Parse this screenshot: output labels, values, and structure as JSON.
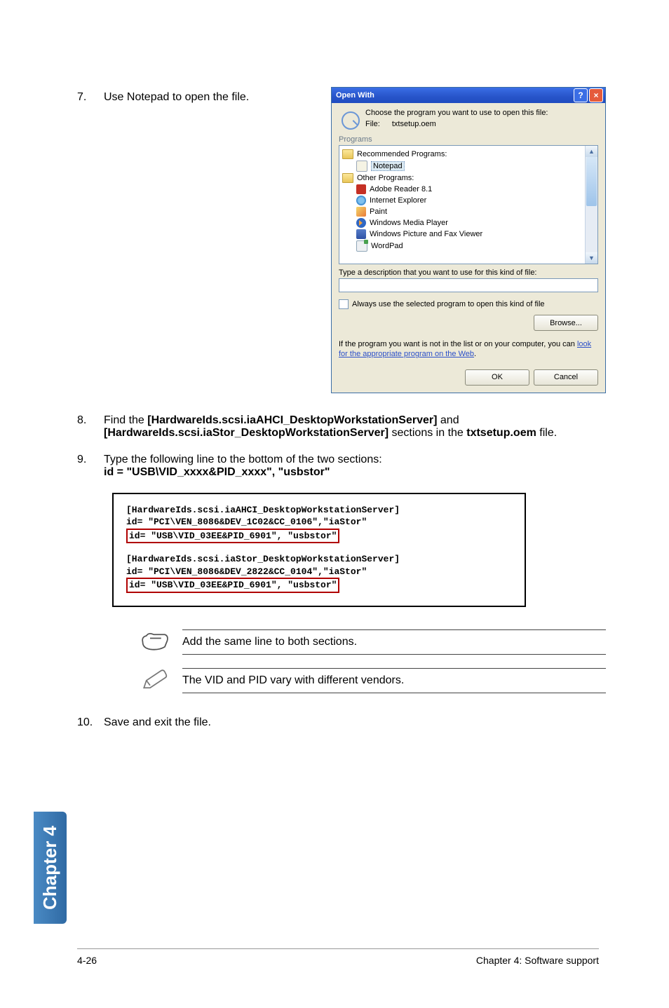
{
  "step7": {
    "num": "7.",
    "text": "Use Notepad to open the file."
  },
  "dialog": {
    "title": "Open With",
    "help": "?",
    "close": "×",
    "choose": "Choose the program you want to use to open this file:",
    "file_label": "File:",
    "file_name": "txtsetup.oem",
    "programs_label": "Programs",
    "grp_rec": "Recommended Programs:",
    "notepad": "Notepad",
    "grp_other": "Other Programs:",
    "adobe": "Adobe Reader 8.1",
    "ie": "Internet Explorer",
    "paint": "Paint",
    "wmp": "Windows Media Player",
    "picfax": "Windows Picture and Fax Viewer",
    "wordpad": "WordPad",
    "desc_label": "Type a description that you want to use for this kind of file:",
    "always": "Always use the selected program to open this kind of file",
    "browse": "Browse...",
    "weblook_a": "If the program you want is not in the list or on your computer, you can ",
    "weblook_link": "look for the appropriate program on the Web",
    "weblook_b": ".",
    "ok": "OK",
    "cancel": "Cancel"
  },
  "step8": {
    "num": "8.",
    "a": "Find the ",
    "b": "[HardwareIds.scsi.iaAHCI_DesktopWorkstationServer]",
    "c": " and ",
    "d": "[HardwareIds.scsi.iaStor_DesktopWorkstationServer]",
    "e": " sections in the ",
    "f": "txtsetup.oem",
    "g": " file."
  },
  "step9": {
    "num": "9.",
    "a": "Type the following line to the bottom of the two sections:",
    "b": "id = \"USB\\VID_xxxx&PID_xxxx\", \"usbstor\""
  },
  "code": {
    "l1": "[HardwareIds.scsi.iaAHCI_DesktopWorkstationServer]",
    "l2": "id= \"PCI\\VEN_8086&DEV_1C02&CC_0106\",\"iaStor\"",
    "l3": "id= \"USB\\VID_03EE&PID_6901\", \"usbstor\"",
    "l4": "[HardwareIds.scsi.iaStor_DesktopWorkstationServer]",
    "l5": "id= \"PCI\\VEN_8086&DEV_2822&CC_0104\",\"iaStor\"",
    "l6": "id= \"USB\\VID_03EE&PID_6901\", \"usbstor\""
  },
  "note1": "Add the same line to both sections.",
  "note2": "The VID and PID vary with different vendors.",
  "step10": {
    "num": "10.",
    "text": "Save and exit the file."
  },
  "sidetab": "Chapter 4",
  "footer": {
    "left": "4-26",
    "right": "Chapter 4: Software support"
  }
}
